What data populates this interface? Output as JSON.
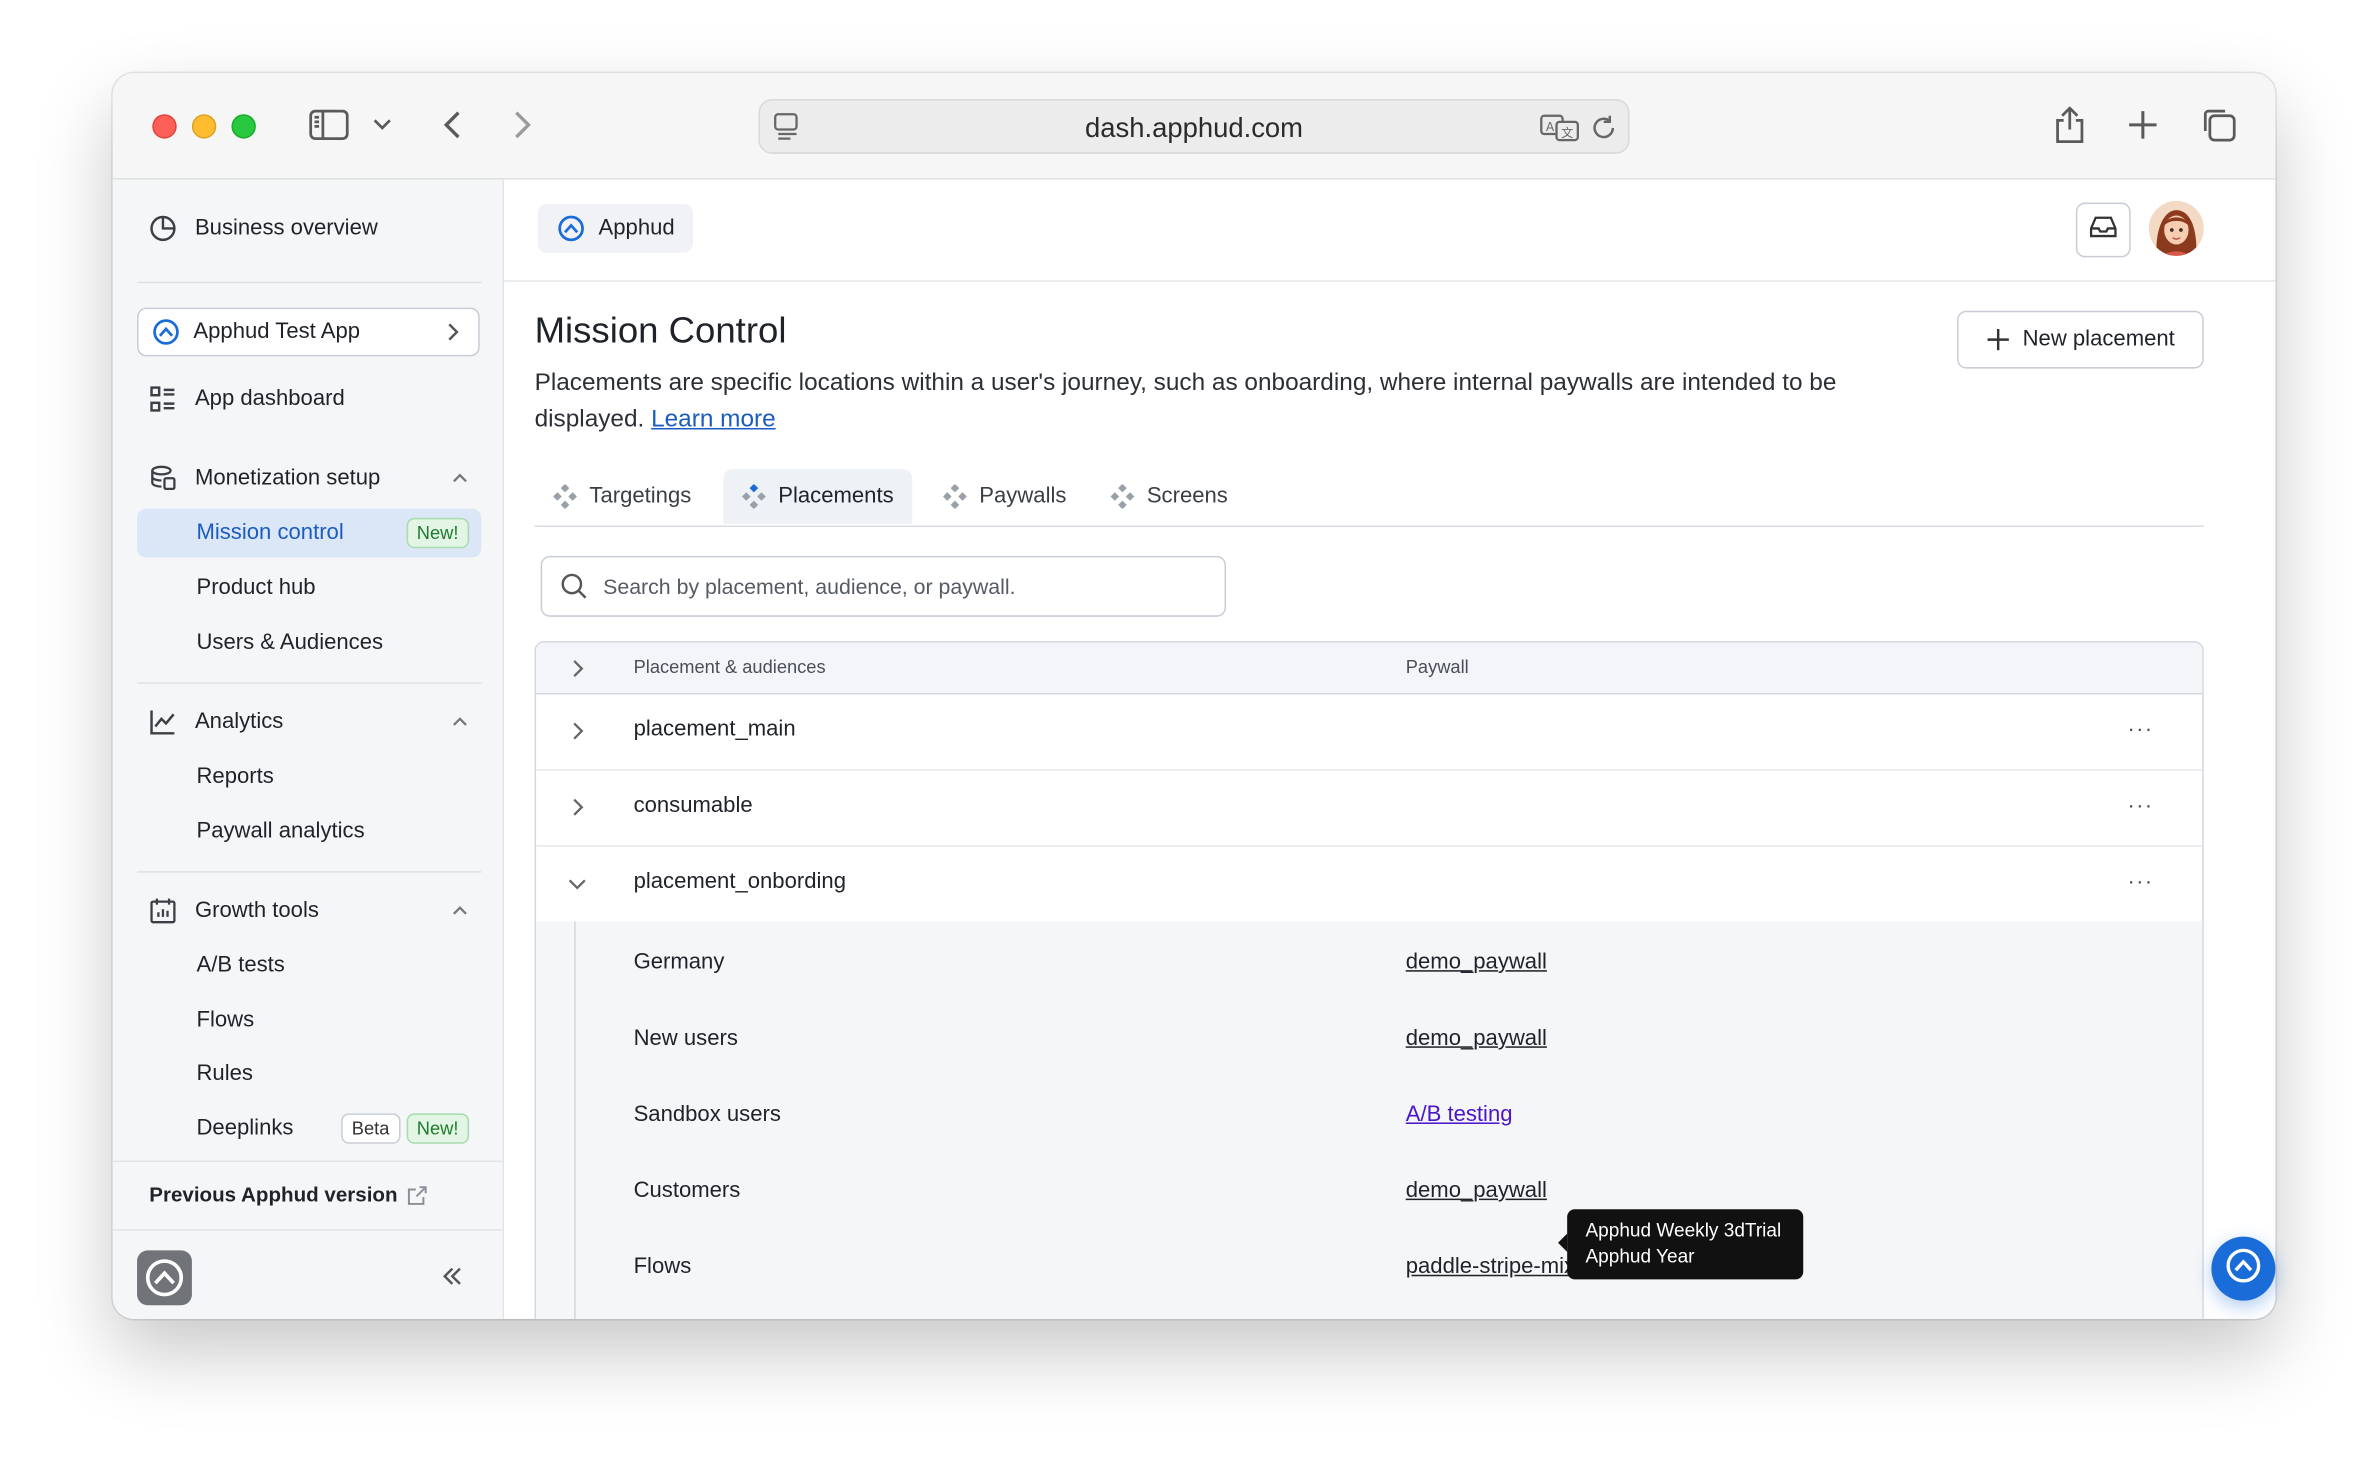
{
  "browser": {
    "url": "dash.apphud.com"
  },
  "sidebar": {
    "business_overview": "Business overview",
    "app_selector": "Apphud Test App",
    "app_dashboard": "App dashboard",
    "monetization": {
      "label": "Monetization setup",
      "items": [
        {
          "label": "Mission control",
          "badge": "New!",
          "active": true
        },
        {
          "label": "Product hub"
        },
        {
          "label": "Users & Audiences"
        }
      ]
    },
    "analytics": {
      "label": "Analytics",
      "items": [
        {
          "label": "Reports"
        },
        {
          "label": "Paywall analytics"
        }
      ]
    },
    "growth": {
      "label": "Growth tools",
      "items": [
        {
          "label": "A/B tests"
        },
        {
          "label": "Flows"
        },
        {
          "label": "Rules"
        },
        {
          "label": "Deeplinks",
          "badges": [
            "Beta",
            "New!"
          ]
        }
      ]
    },
    "previous_version": "Previous Apphud version"
  },
  "header": {
    "app_chip": "Apphud"
  },
  "page": {
    "title": "Mission Control",
    "description": "Placements are specific locations within a user's journey, such as onboarding, where internal paywalls are intended to be displayed.",
    "learn_more": "Learn more",
    "new_placement": "New placement"
  },
  "tabs": [
    {
      "label": "Targetings"
    },
    {
      "label": "Placements",
      "active": true
    },
    {
      "label": "Paywalls"
    },
    {
      "label": "Screens"
    }
  ],
  "search": {
    "placeholder": "Search by placement, audience, or paywall."
  },
  "table": {
    "columns": [
      "Placement & audiences",
      "Paywall"
    ],
    "rows": [
      {
        "name": "placement_main",
        "expanded": false
      },
      {
        "name": "consumable",
        "expanded": false
      },
      {
        "name": "placement_onbording",
        "expanded": true
      }
    ],
    "audiences": [
      {
        "name": "Germany",
        "paywall": "demo_paywall"
      },
      {
        "name": "New users",
        "paywall": "demo_paywall"
      },
      {
        "name": "Sandbox users",
        "paywall": "A/B testing"
      },
      {
        "name": "Customers",
        "paywall": "demo_paywall"
      },
      {
        "name": "Flows",
        "paywall": "paddle-stripe-mix"
      }
    ],
    "more_label": "···"
  },
  "tooltip": {
    "line1": "Apphud Weekly 3dTrial",
    "line2": "Apphud Year"
  },
  "colors": {
    "accent": "#1a6dd8",
    "active_nav_bg": "#dbe7f7",
    "ab_link": "#4b16c9"
  }
}
